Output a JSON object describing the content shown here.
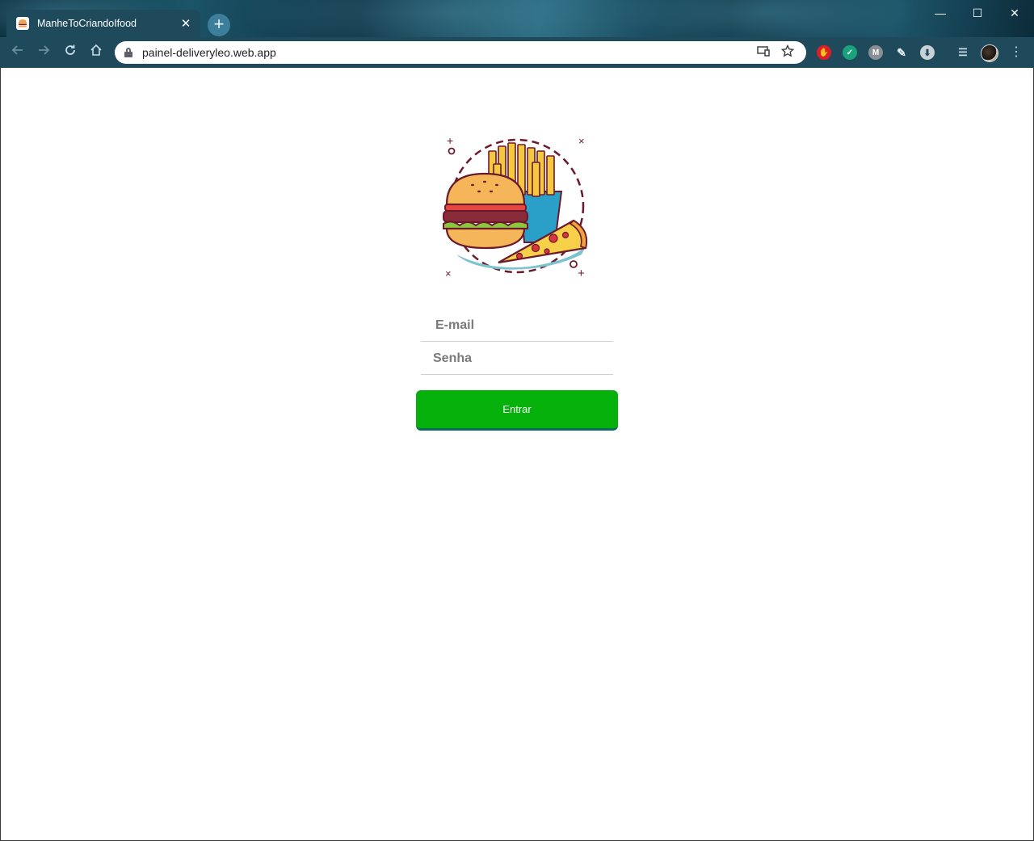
{
  "browser": {
    "tab_title": "ManheToCriandoIfood",
    "url": "painel-deliveryleo.web.app",
    "newtab_symbol": "+",
    "close_symbol": "✕",
    "window_controls": {
      "minimize": "—",
      "maximize": "☐",
      "close": "✕"
    }
  },
  "login": {
    "email_placeholder": "E-mail",
    "password_placeholder": "Senha",
    "submit_label": "Entrar"
  },
  "colors": {
    "button": "#05b10a",
    "button_border": "#0c6b5a"
  },
  "icons": {
    "logo": "burger-fries-pizza-icon",
    "password_toggle": "eye-icon"
  }
}
